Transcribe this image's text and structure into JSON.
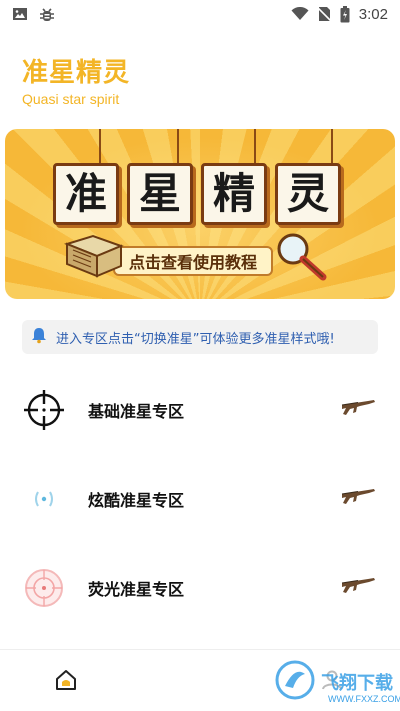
{
  "status_bar": {
    "time": "3:02",
    "icons": [
      "image-icon",
      "bug-icon",
      "wifi-icon",
      "no-sim-icon",
      "battery-icon"
    ]
  },
  "header": {
    "title": "准星精灵",
    "subtitle": "Quasi star spirit"
  },
  "banner": {
    "tiles": [
      "准",
      "星",
      "精",
      "灵"
    ],
    "ribbon_text": "点击查看使用教程"
  },
  "notice": {
    "icon": "bell-icon",
    "text": "进入专区点击“切换准星”可体验更多准星样式哦!"
  },
  "zones": [
    {
      "label": "基础准星专区",
      "icon": "crosshair-basic-icon",
      "action_icon": "rifle-icon"
    },
    {
      "label": "炫酷准星专区",
      "icon": "crosshair-cool-icon",
      "action_icon": "rifle-icon"
    },
    {
      "label": "荧光准星专区",
      "icon": "crosshair-glow-icon",
      "action_icon": "rifle-icon"
    }
  ],
  "bottom_nav": {
    "items": [
      "home-icon",
      "user-icon"
    ]
  },
  "watermark": {
    "text": "飞翔下载",
    "url": "WWW.FXXZ.COM"
  },
  "colors": {
    "accent": "#f3b526",
    "notice_text": "#2f5fb0",
    "banner_bg": "#f6b838"
  }
}
